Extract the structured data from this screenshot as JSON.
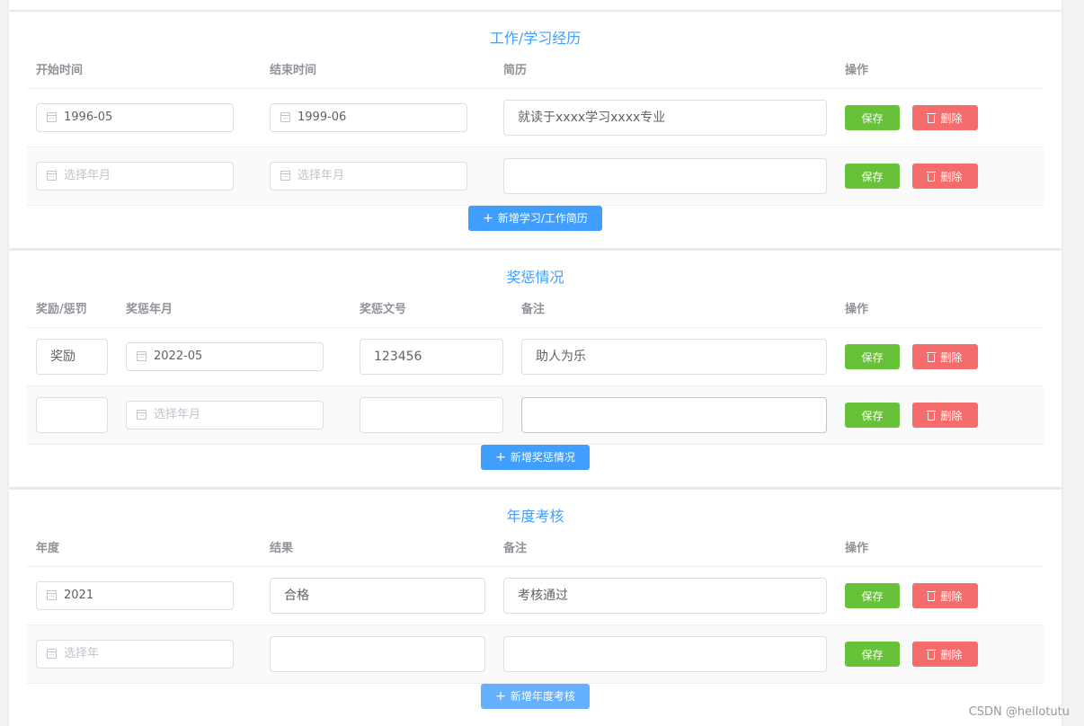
{
  "sections": {
    "work": {
      "title": "工作/学习经历",
      "headers": [
        "开始时间",
        "结束时间",
        "简历",
        "操作"
      ],
      "rows": [
        {
          "start": "1996-05",
          "end": "1999-06",
          "resume": "就读于xxxx学习xxxx专业"
        },
        {
          "start_placeholder": "选择年月",
          "end_placeholder": "选择年月",
          "resume": ""
        }
      ],
      "add_label": "新增学习/工作简历"
    },
    "reward": {
      "title": "奖惩情况",
      "headers": [
        "奖励/惩罚",
        "奖惩年月",
        "奖惩文号",
        "备注",
        "操作"
      ],
      "rows": [
        {
          "type": "奖励",
          "date": "2022-05",
          "doc_no": "123456",
          "remark": "助人为乐"
        },
        {
          "type": "",
          "date_placeholder": "选择年月",
          "doc_no": "",
          "remark": ""
        }
      ],
      "add_label": "新增奖惩情况"
    },
    "annual": {
      "title": "年度考核",
      "headers": [
        "年度",
        "结果",
        "备注",
        "操作"
      ],
      "rows": [
        {
          "year": "2021",
          "result": "合格",
          "remark": "考核通过"
        },
        {
          "year_placeholder": "选择年",
          "result": "",
          "remark": ""
        }
      ],
      "add_label": "新增年度考核"
    }
  },
  "actions": {
    "save_label": "保存",
    "delete_label": "删除"
  },
  "icons": {
    "calendar": "calendar-icon",
    "delete": "trash-icon",
    "add": "plus-icon"
  },
  "colors": {
    "title": "#409eff",
    "save": "#67c23a",
    "delete": "#f56c6c",
    "add": "#409eff"
  },
  "watermark": "CSDN @hellotutu"
}
